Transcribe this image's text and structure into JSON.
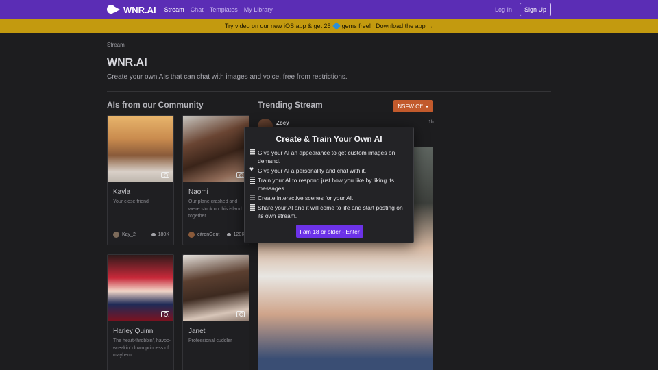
{
  "nav": {
    "logo_text": "WNR.AI",
    "links": [
      "Stream",
      "Chat",
      "Templates",
      "My Library"
    ],
    "login": "Log In",
    "signup": "Sign Up"
  },
  "banner": {
    "text_before": "Try video on our new iOS app & get 25",
    "text_after": "gems free!",
    "link": "Download the app →"
  },
  "header": {
    "breadcrumb": "Stream",
    "title": "WNR.AI",
    "subtitle": "Create your own AIs that can chat with images and voice, free from restrictions."
  },
  "community": {
    "title": "AIs from our Community",
    "cards": [
      {
        "name": "Kayla",
        "desc": "Your close friend",
        "creator": "Kay_2",
        "chats": "180K"
      },
      {
        "name": "Naomi",
        "desc": "Our plane crashed and we're stuck on this island together.",
        "creator": "citronGent",
        "chats": "120K"
      },
      {
        "name": "Harley Quinn",
        "desc": "The heart-throbbin', havoc-wreakin' clown princess of mayhem",
        "creator": "",
        "chats": ""
      },
      {
        "name": "Janet",
        "desc": "Professional cuddler",
        "creator": "",
        "chats": ""
      }
    ]
  },
  "trending": {
    "title": "Trending Stream",
    "filter": "NSFW Off",
    "post": {
      "user": "Zoey",
      "time": "1h"
    }
  },
  "modal": {
    "title": "Create & Train Your Own AI",
    "items": [
      "Give your AI an appearance to get custom images on demand.",
      "Give your AI a personality and chat with it.",
      "Train your AI to respond just how you like by liking its messages.",
      "Create interactive scenes for your AI.",
      "Share your AI and it will come to life and start posting on its own stream."
    ],
    "enter_button": "I am 18 or older - Enter"
  },
  "colors": {
    "nav_bg": "#5b2db5",
    "banner_bg": "#c39a0f",
    "accent_button": "#6c32e8",
    "nsfw_button": "#c25a2c",
    "page_bg": "#1d1d1f"
  }
}
